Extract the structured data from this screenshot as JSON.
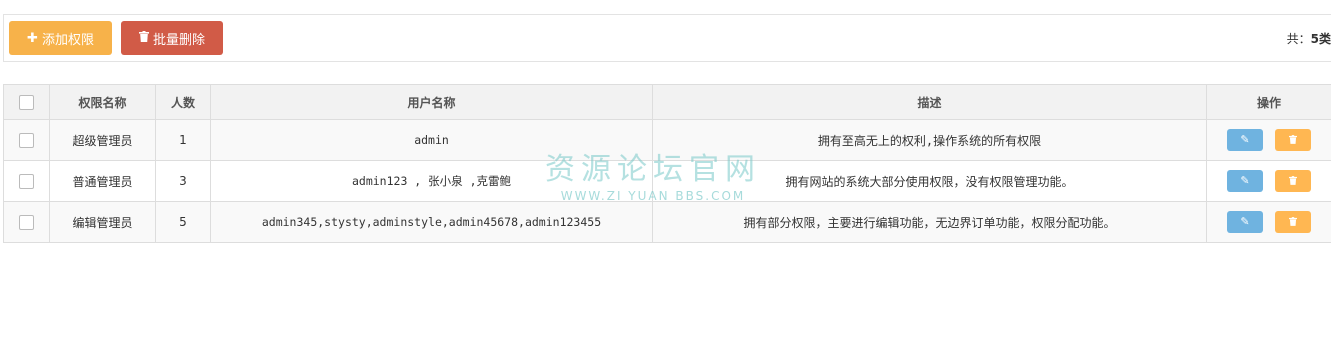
{
  "toolbar": {
    "add_label": "添加权限",
    "add_icon": "plus-icon",
    "batch_delete_label": "批量删除",
    "batch_delete_icon": "trash-icon",
    "total_prefix": "共：",
    "total_count": "5",
    "total_suffix": "类"
  },
  "table": {
    "headers": {
      "name": "权限名称",
      "count": "人数",
      "users": "用户名称",
      "desc": "描述",
      "ops": "操作"
    },
    "rows": [
      {
        "name": "超级管理员",
        "count": "1",
        "users": "admin",
        "desc": "拥有至高无上的权利,操作系统的所有权限"
      },
      {
        "name": "普通管理员",
        "count": "3",
        "users": "admin123 , 张小泉 ,克雷鲍",
        "desc": "拥有网站的系统大部分使用权限，没有权限管理功能。"
      },
      {
        "name": "编辑管理员",
        "count": "5",
        "users": "admin345,stysty,adminstyle,admin45678,admin123455",
        "desc": "拥有部分权限，主要进行编辑功能，无边界订单功能，权限分配功能。"
      }
    ],
    "row_actions": {
      "edit_icon": "edit-icon",
      "delete_icon": "trash-icon"
    }
  },
  "watermark": {
    "main": "资源论坛官网",
    "sub": "WWW.ZI YUAN BBS.COM"
  },
  "colors": {
    "add_button": "#f7b24a",
    "batch_delete_button": "#d15b47",
    "edit_button": "#6fb3e0",
    "delete_button": "#ffb752",
    "header_bg": "#f2f2f2"
  }
}
